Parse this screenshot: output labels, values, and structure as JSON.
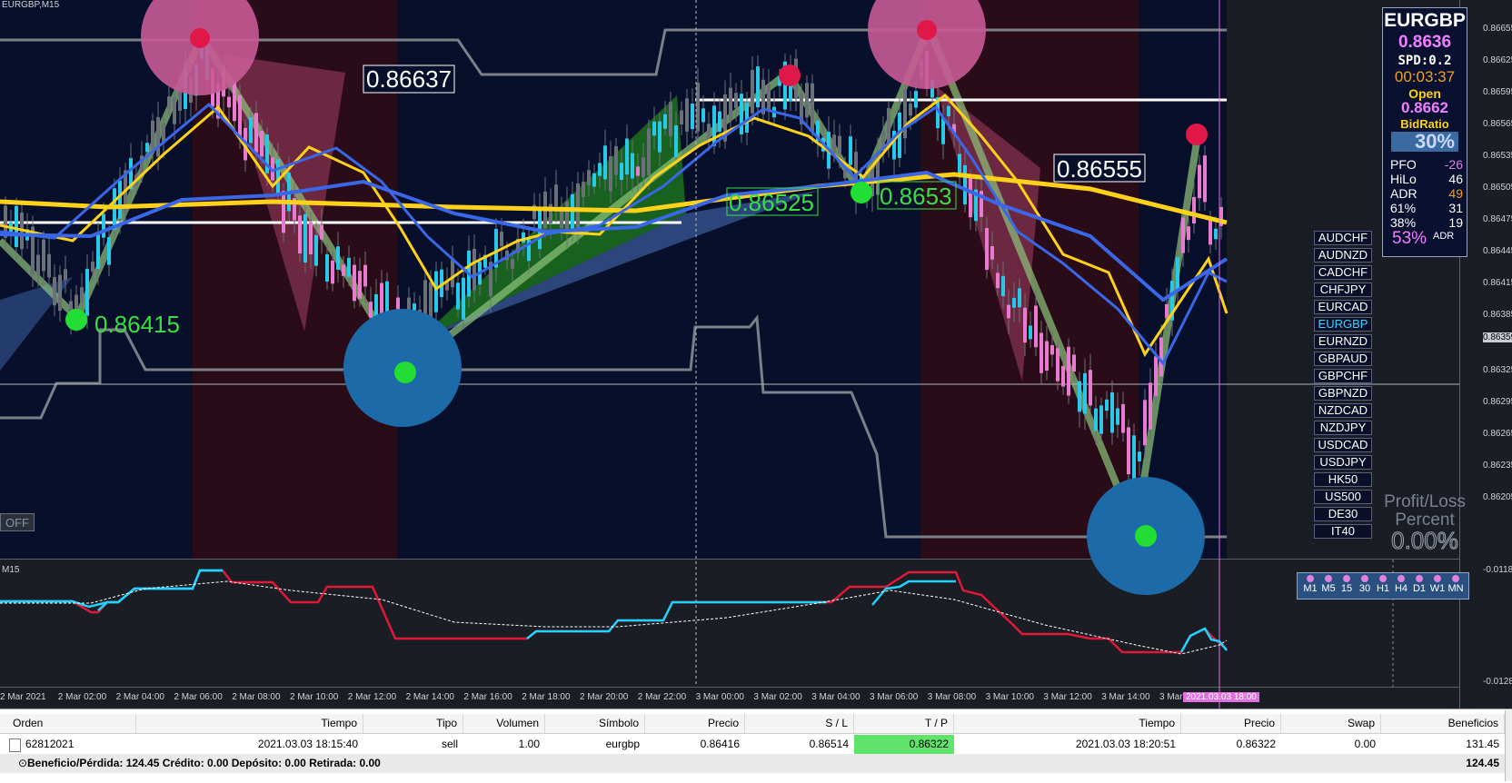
{
  "window": {
    "title": "EURGBP,M15",
    "subtitle": "M15"
  },
  "main_chart": {
    "price_axis": [
      "0.86655",
      "0.86625",
      "0.86595",
      "0.86565",
      "0.86535",
      "0.86505",
      "0.86475",
      "0.86445",
      "0.86415",
      "0.86385",
      "0.86359",
      "0.86325",
      "0.86295",
      "0.86265",
      "0.86235",
      "0.86205"
    ],
    "current_price_label": "0.86359",
    "labels": {
      "upper_left": "0.86637",
      "left_low": "0.86415",
      "mid": "0.86525",
      "mid_right": "0.8653",
      "right": "0.86555"
    },
    "off_button": "OFF",
    "colors": {
      "background": "#070f2a",
      "bear_zone": "#2a0c18",
      "yellow": "#ffd21a",
      "blue": "#3a66e8",
      "pink": "#e87ad0",
      "cyan": "#28c8e8"
    }
  },
  "sub_chart": {
    "axis": [
      "-0.0118",
      "-0.0128"
    ],
    "cyan_color": "#1fd2ff",
    "red_color": "#e01838"
  },
  "time_axis": [
    "2 Mar 2021",
    "2 Mar 02:00",
    "2 Mar 04:00",
    "2 Mar 06:00",
    "2 Mar 08:00",
    "2 Mar 10:00",
    "2 Mar 12:00",
    "2 Mar 14:00",
    "2 Mar 16:00",
    "2 Mar 18:00",
    "2 Mar 20:00",
    "2 Mar 22:00",
    "3 Mar 00:00",
    "3 Mar 02:00",
    "3 Mar 04:00",
    "3 Mar 06:00",
    "3 Mar 08:00",
    "3 Mar 10:00",
    "3 Mar 12:00",
    "3 Mar 14:00",
    "3 Mar"
  ],
  "time_highlight": "2021.03.03 18:00",
  "info_panel": {
    "symbol": "EURGBP",
    "bid": "0.8636",
    "spread": "SPD:0.2",
    "timer": "00:03:37",
    "open_label": "Open",
    "open_value": "0.8662",
    "bid_ratio_label": "BidRatio",
    "bid_ratio_value": "30%",
    "stats": [
      {
        "label": "PFO",
        "value": "-26"
      },
      {
        "label": "HiLo",
        "value": "46"
      },
      {
        "label": "ADR",
        "value": "49"
      },
      {
        "label": "61%",
        "value": "31"
      },
      {
        "label": "38%",
        "value": "19"
      }
    ],
    "adr_pct": "53%",
    "adr_tag": "ADR"
  },
  "symbols": [
    "AUDCHF",
    "AUDNZD",
    "CADCHF",
    "CHFJPY",
    "EURCAD",
    "EURGBP",
    "EURNZD",
    "GBPAUD",
    "GBPCHF",
    "GBPNZD",
    "NZDCAD",
    "NZDJPY",
    "USDCAD",
    "USDJPY",
    "HK50",
    "US500",
    "DE30",
    "IT40"
  ],
  "active_symbol": "EURGBP",
  "profit_loss": {
    "line1": "Profit/Loss",
    "line2": "Percent",
    "value": "0.00%"
  },
  "timeframes": [
    "M1",
    "M5",
    "15",
    "30",
    "H1",
    "H4",
    "D1",
    "W1",
    "MN"
  ],
  "terminal": {
    "headers": [
      "Orden",
      "Tiempo",
      "Tipo",
      "Volumen",
      "Símbolo",
      "Precio",
      "S / L",
      "T / P",
      "Tiempo",
      "Precio",
      "Swap",
      "Beneficios"
    ],
    "row": [
      "62812021",
      "2021.03.03 18:15:40",
      "sell",
      "1.00",
      "eurgbp",
      "0.86416",
      "0.86514",
      "0.86322",
      "2021.03.03 18:20:51",
      "0.86322",
      "0.00",
      "131.45"
    ],
    "summary": "Beneficio/Pérdida: 124.45  Crédito: 0.00  Depósito: 0.00  Retirada: 0.00",
    "summary_total": "124.45"
  }
}
